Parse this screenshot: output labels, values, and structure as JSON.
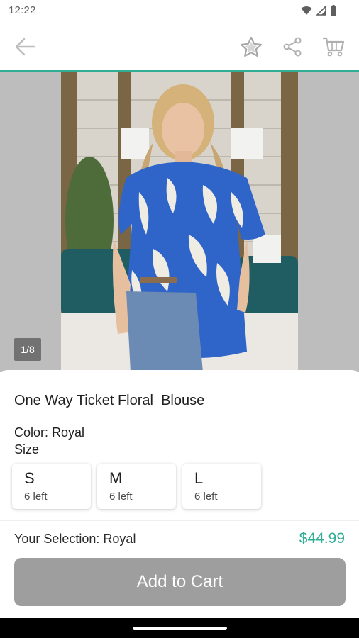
{
  "status": {
    "time": "12:22"
  },
  "header": {
    "icons": [
      "back-arrow-icon",
      "star-icon",
      "share-icon",
      "cart-icon"
    ],
    "accent": "#2fae95"
  },
  "gallery": {
    "counter": "1/8"
  },
  "product": {
    "title": "One Way Ticket Floral  Blouse",
    "color_line": "Color: Royal",
    "size_label": "Size",
    "sizes": [
      {
        "letter": "S",
        "stock": "6 left"
      },
      {
        "letter": "M",
        "stock": "6 left"
      },
      {
        "letter": "L",
        "stock": "6 left"
      }
    ],
    "selection": "Your Selection: Royal",
    "price": "$44.99"
  },
  "actions": {
    "add_to_cart": "Add to Cart"
  }
}
